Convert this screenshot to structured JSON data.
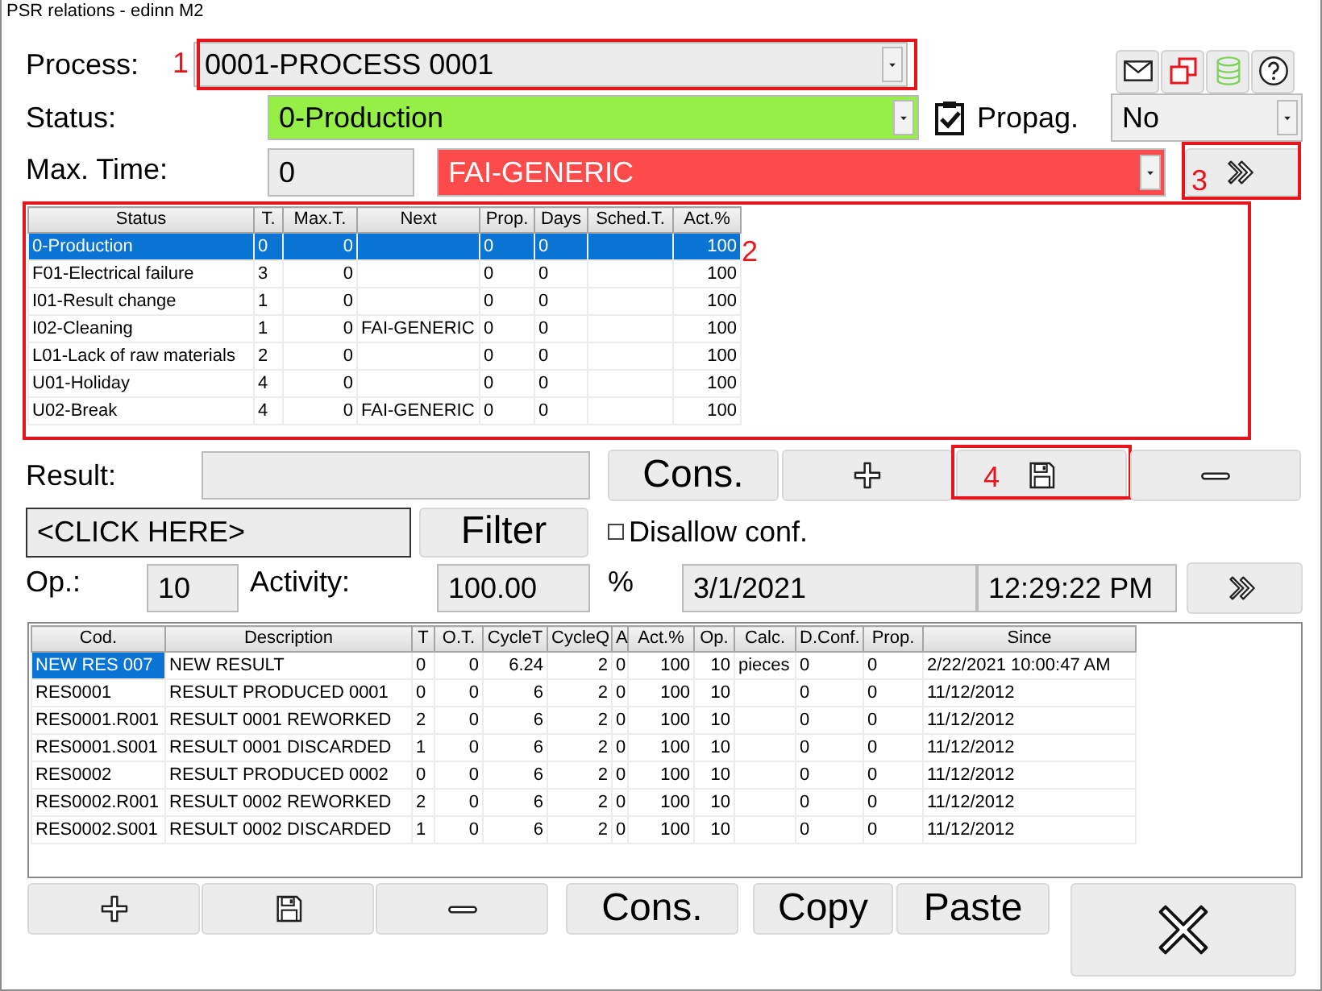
{
  "window": {
    "title": "PSR relations - edinn M2"
  },
  "toolbar_icons": [
    {
      "kind": "mail"
    },
    {
      "kind": "windows"
    },
    {
      "kind": "database"
    },
    {
      "kind": "help"
    }
  ],
  "process": {
    "label": "Process:",
    "value": "0001-PROCESS 0001",
    "annotation": "1"
  },
  "status": {
    "label": "Status:",
    "value": "0-Production"
  },
  "propagate": {
    "checked": true,
    "label": "Propag.",
    "value": "No"
  },
  "max_time": {
    "label": "Max. Time:",
    "value": "0"
  },
  "next_status": {
    "value": "FAI-GENERIC"
  },
  "next_button": {
    "annotation": "3"
  },
  "status_table": {
    "annotation": "2",
    "columns": [
      "Status",
      "T.",
      "Max.T.",
      "Next",
      "Prop.",
      "Days",
      "Sched.T.",
      "Act.%"
    ],
    "rows": [
      {
        "selected": true,
        "cells": [
          "0-Production",
          "0",
          "0",
          "",
          "0",
          "0",
          "",
          "100"
        ]
      },
      {
        "selected": false,
        "cells": [
          "F01-Electrical failure",
          "3",
          "0",
          "",
          "0",
          "0",
          "",
          "100"
        ]
      },
      {
        "selected": false,
        "cells": [
          "I01-Result change",
          "1",
          "0",
          "",
          "0",
          "0",
          "",
          "100"
        ]
      },
      {
        "selected": false,
        "cells": [
          "I02-Cleaning",
          "1",
          "0",
          "FAI-GENERIC",
          "0",
          "0",
          "",
          "100"
        ]
      },
      {
        "selected": false,
        "cells": [
          "L01-Lack of raw materials",
          "2",
          "0",
          "",
          "0",
          "0",
          "",
          "100"
        ]
      },
      {
        "selected": false,
        "cells": [
          "U01-Holiday",
          "4",
          "0",
          "",
          "0",
          "0",
          "",
          "100"
        ]
      },
      {
        "selected": false,
        "cells": [
          "U02-Break",
          "4",
          "0",
          "FAI-GENERIC",
          "0",
          "0",
          "",
          "100"
        ]
      }
    ]
  },
  "result": {
    "label": "Result:"
  },
  "result_buttons": [
    {
      "kind": "text",
      "label": "Cons."
    },
    {
      "kind": "add"
    },
    {
      "kind": "save",
      "annotation": "4"
    },
    {
      "kind": "remove"
    }
  ],
  "filter": {
    "value": "<CLICK HERE>",
    "button": "Filter"
  },
  "disallow_conf": {
    "label": "Disallow conf.",
    "checked": false
  },
  "op": {
    "label": "Op.:",
    "value": "10"
  },
  "activity": {
    "label": "Activity:",
    "value": "100.00",
    "unit": "%"
  },
  "date": "3/1/2021",
  "time": "12:29:22 PM",
  "results_table": {
    "columns": [
      "Cod.",
      "Description",
      "T",
      "O.T.",
      "CycleT",
      "CycleQ",
      "A",
      "Act.%",
      "Op.",
      "Calc.",
      "D.Conf.",
      "Prop.",
      "Since"
    ],
    "rows": [
      {
        "selected": true,
        "cells": [
          "NEW RES 007",
          "NEW RESULT",
          "0",
          "0",
          "6.24",
          "2",
          "0",
          "100",
          "10",
          "pieces",
          "0",
          "0",
          "2/22/2021 10:00:47 AM"
        ]
      },
      {
        "selected": false,
        "cells": [
          "RES0001",
          "RESULT PRODUCED 0001",
          "0",
          "0",
          "6",
          "2",
          "0",
          "100",
          "10",
          "",
          "0",
          "0",
          "11/12/2012"
        ]
      },
      {
        "selected": false,
        "cells": [
          "RES0001.R001",
          "RESULT 0001 REWORKED",
          "2",
          "0",
          "6",
          "2",
          "0",
          "100",
          "10",
          "",
          "0",
          "0",
          "11/12/2012"
        ]
      },
      {
        "selected": false,
        "cells": [
          "RES0001.S001",
          "RESULT 0001 DISCARDED",
          "1",
          "0",
          "6",
          "2",
          "0",
          "100",
          "10",
          "",
          "0",
          "0",
          "11/12/2012"
        ]
      },
      {
        "selected": false,
        "cells": [
          "RES0002",
          "RESULT PRODUCED 0002",
          "0",
          "0",
          "6",
          "2",
          "0",
          "100",
          "10",
          "",
          "0",
          "0",
          "11/12/2012"
        ]
      },
      {
        "selected": false,
        "cells": [
          "RES0002.R001",
          "RESULT 0002 REWORKED",
          "2",
          "0",
          "6",
          "2",
          "0",
          "100",
          "10",
          "",
          "0",
          "0",
          "11/12/2012"
        ]
      },
      {
        "selected": false,
        "cells": [
          "RES0002.S001",
          "RESULT 0002 DISCARDED",
          "1",
          "0",
          "6",
          "2",
          "0",
          "100",
          "10",
          "",
          "0",
          "0",
          "11/12/2012"
        ]
      }
    ]
  },
  "bottom_buttons": [
    {
      "kind": "add"
    },
    {
      "kind": "save"
    },
    {
      "kind": "remove"
    },
    {
      "kind": "text",
      "label": "Cons."
    },
    {
      "kind": "text",
      "label": "Copy"
    },
    {
      "kind": "text",
      "label": "Paste"
    },
    {
      "kind": "close"
    }
  ]
}
